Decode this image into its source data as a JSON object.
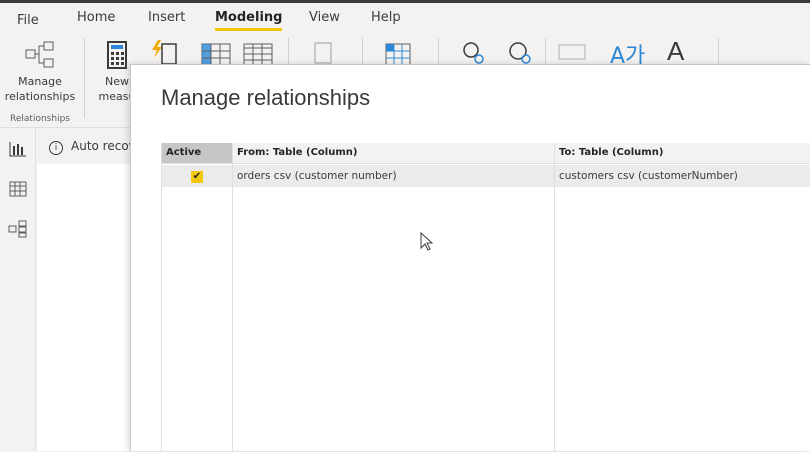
{
  "ribbon": {
    "tabs": [
      "File",
      "Home",
      "Insert",
      "Modeling",
      "View",
      "Help"
    ],
    "active_tab": "Modeling",
    "accent": "#f2c811",
    "manage_relationships_line1": "Manage",
    "manage_relationships_line2": "relationships",
    "new_measure_line1": "New",
    "new_measure_line2": "measu",
    "group_relationships": "Relationships"
  },
  "infobar": {
    "text": "Auto recov"
  },
  "dialog": {
    "title": "Manage relationships",
    "columns": [
      "Active",
      "From: Table (Column)",
      "To: Table (Column)"
    ],
    "rows": [
      {
        "active": true,
        "from": "orders csv (customer number)",
        "to": "customers csv (customerNumber)"
      }
    ]
  }
}
